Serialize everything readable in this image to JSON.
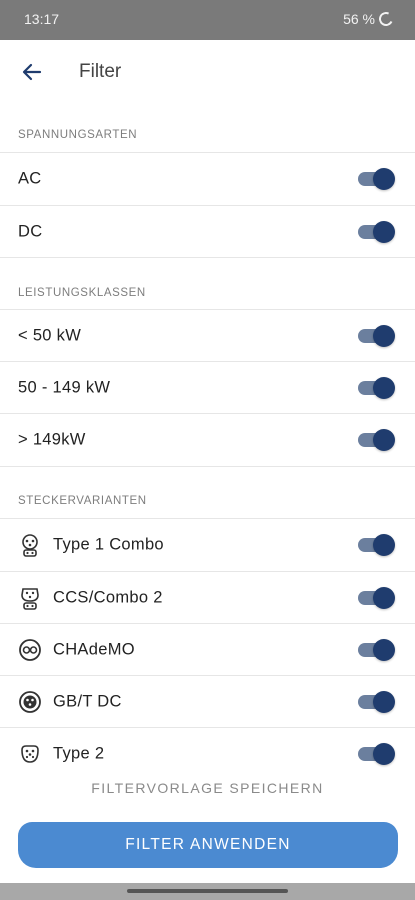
{
  "status_bar": {
    "time": "13:17",
    "battery": "56 %"
  },
  "app_bar": {
    "title": "Filter",
    "back_icon": "arrow-left-icon"
  },
  "sections": {
    "voltage": {
      "title": "SPANNUNGSARTEN",
      "items": [
        {
          "label": "AC",
          "enabled": true
        },
        {
          "label": "DC",
          "enabled": true
        }
      ]
    },
    "power": {
      "title": "LEISTUNGSKLASSEN",
      "items": [
        {
          "label": "< 50 kW",
          "enabled": true
        },
        {
          "label": "50 - 149 kW",
          "enabled": true
        },
        {
          "label": "> 149kW",
          "enabled": true
        }
      ]
    },
    "plugs": {
      "title": "STECKERVARIANTEN",
      "items": [
        {
          "label": "Type 1 Combo",
          "icon": "type1-combo-plug-icon",
          "enabled": true
        },
        {
          "label": "CCS/Combo 2",
          "icon": "ccs-combo2-plug-icon",
          "enabled": true
        },
        {
          "label": "CHAdeMO",
          "icon": "chademo-plug-icon",
          "enabled": true
        },
        {
          "label": "GB/T DC",
          "icon": "gbt-dc-plug-icon",
          "enabled": true
        },
        {
          "label": "Type 2",
          "icon": "type2-plug-icon",
          "enabled": true
        }
      ]
    }
  },
  "actions": {
    "save_template": "FILTERVORLAGE SPEICHERN",
    "apply": "FILTER ANWENDEN"
  },
  "colors": {
    "toggle_thumb": "#1f3c6e",
    "toggle_track": "#6b7f9e",
    "apply_button": "#4b8ad1"
  }
}
